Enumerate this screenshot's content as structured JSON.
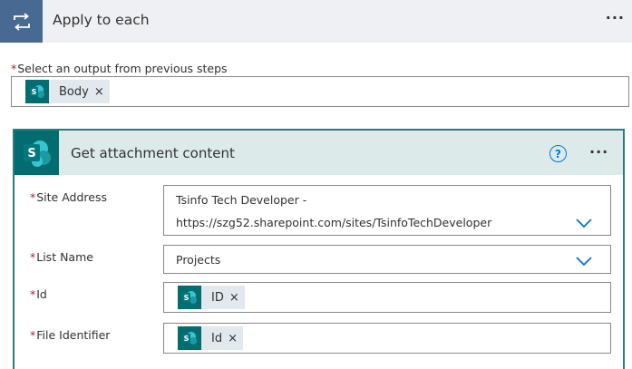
{
  "loop": {
    "title": "Apply to each",
    "menu": "···",
    "field_label": "Select an output from previous steps",
    "required_mark": "*",
    "token": {
      "label": "Body",
      "remove": "×",
      "icon": "sharepoint-icon"
    }
  },
  "action": {
    "title": "Get attachment content",
    "help": "?",
    "menu": "···",
    "fields": {
      "site_address": {
        "label": "Site Address",
        "value_line1": "Tsinfo Tech Developer -",
        "value_line2": "https://szg52.sharepoint.com/sites/TsinfoTechDeveloper"
      },
      "list_name": {
        "label": "List Name",
        "value": "Projects"
      },
      "id": {
        "label": "Id",
        "token": "ID",
        "remove": "×"
      },
      "file_identifier": {
        "label": "File Identifier",
        "token": "Id",
        "remove": "×"
      }
    }
  },
  "colors": {
    "loop_icon_bg": "#486991",
    "sharepoint": "#036c70",
    "action_border": "#2f7a78",
    "required": "#a4262c",
    "chevron": "#0078d4"
  }
}
